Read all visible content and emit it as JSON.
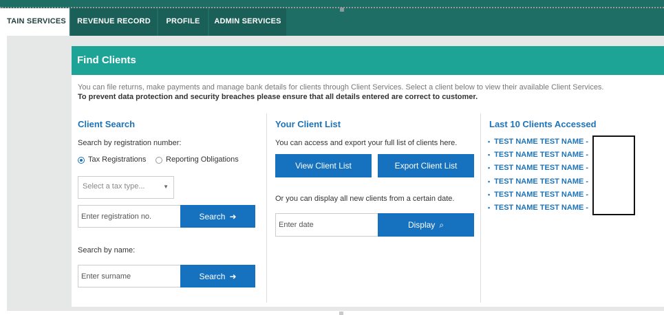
{
  "nav": {
    "tabs": [
      {
        "label": "TAIN SERVICES"
      },
      {
        "label": "REVENUE RECORD"
      },
      {
        "label": "PROFILE"
      },
      {
        "label": "ADMIN SERVICES"
      }
    ]
  },
  "card": {
    "title": "Find Clients",
    "intro_line1": "You can file returns, make payments and manage bank details for clients through Client Services. Select a client below to view their available Client Services.",
    "intro_line2": "To prevent data protection and security breaches please ensure that all details entered are correct to customer."
  },
  "client_search": {
    "heading": "Client Search",
    "by_reg_label": "Search by registration number:",
    "radio_tax": "Tax Registrations",
    "radio_reporting": "Reporting Obligations",
    "radio_selected": "Tax Registrations",
    "tax_type_placeholder": "Select a tax type...",
    "reg_placeholder": "Enter registration no.",
    "search_label": "Search",
    "by_name_label": "Search by name:",
    "surname_placeholder": "Enter surname",
    "search_label_2": "Search"
  },
  "client_list": {
    "heading": "Your Client List",
    "description": "You can access and export your full list of clients here.",
    "view_button": "View Client List",
    "export_button": "Export Client List",
    "date_text": "Or you can display all new clients from a certain date.",
    "date_placeholder": "Enter date",
    "display_button": "Display"
  },
  "last_clients": {
    "heading": "Last 10 Clients Accessed",
    "items": [
      "TEST NAME TEST NAME -",
      "TEST NAME TEST NAME -",
      "TEST NAME TEST NAME -",
      "TEST NAME TEST NAME -",
      "TEST NAME TEST NAME -",
      "TEST NAME TEST NAME -"
    ]
  },
  "colors": {
    "nav_bg": "#1f6e66",
    "header_bg": "#1ea397",
    "heading_blue": "#1d73b8",
    "button_blue": "#1672be"
  },
  "icons": [
    "arrow-right-icon",
    "search-icon",
    "chevron-down-icon"
  ]
}
